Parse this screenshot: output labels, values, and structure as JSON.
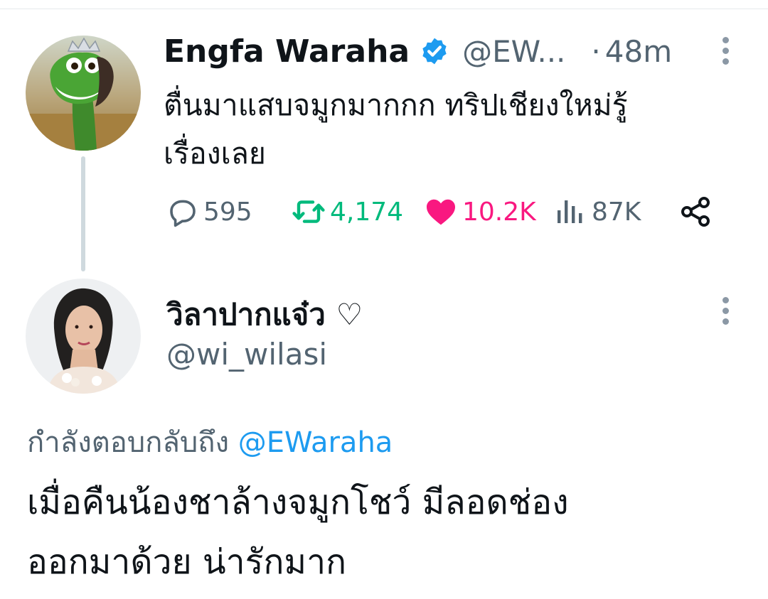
{
  "tweet": {
    "display_name": "Engfa Waraha",
    "handle": "@EW...",
    "dot": "·",
    "time": "48m",
    "text_line1": "ตื่นมาแสบจมูกมากกก ทริปเชียงใหม่รู้",
    "text_line2": "เรื่องเลย",
    "stats": {
      "replies": "595",
      "retweets": "4,174",
      "likes": "10.2K",
      "views": "87K"
    }
  },
  "reply": {
    "display_name": "วิลาปากแจ๋ว ♡",
    "handle": "@wi_wilasi",
    "replying_to_label": "กำลังตอบกลับถึง",
    "replying_to_mention": "@EWaraha",
    "text_line1": "เมื่อคืนน้องชาล้างจมูกโชว์ มีลอดช่อง",
    "text_line2": "ออกมาด้วย น่ารักมาก"
  },
  "colors": {
    "text": "#0f1419",
    "secondary": "#536471",
    "retweet": "#00ba7c",
    "like": "#f91880",
    "link": "#1d9bf0",
    "verified": "#1d9bf0"
  },
  "icons": {
    "reply": "reply-icon",
    "retweet": "retweet-icon",
    "like": "heart-icon",
    "views": "views-icon",
    "share": "share-icon",
    "more": "more-vertical-icon",
    "verified": "verified-badge-icon"
  }
}
